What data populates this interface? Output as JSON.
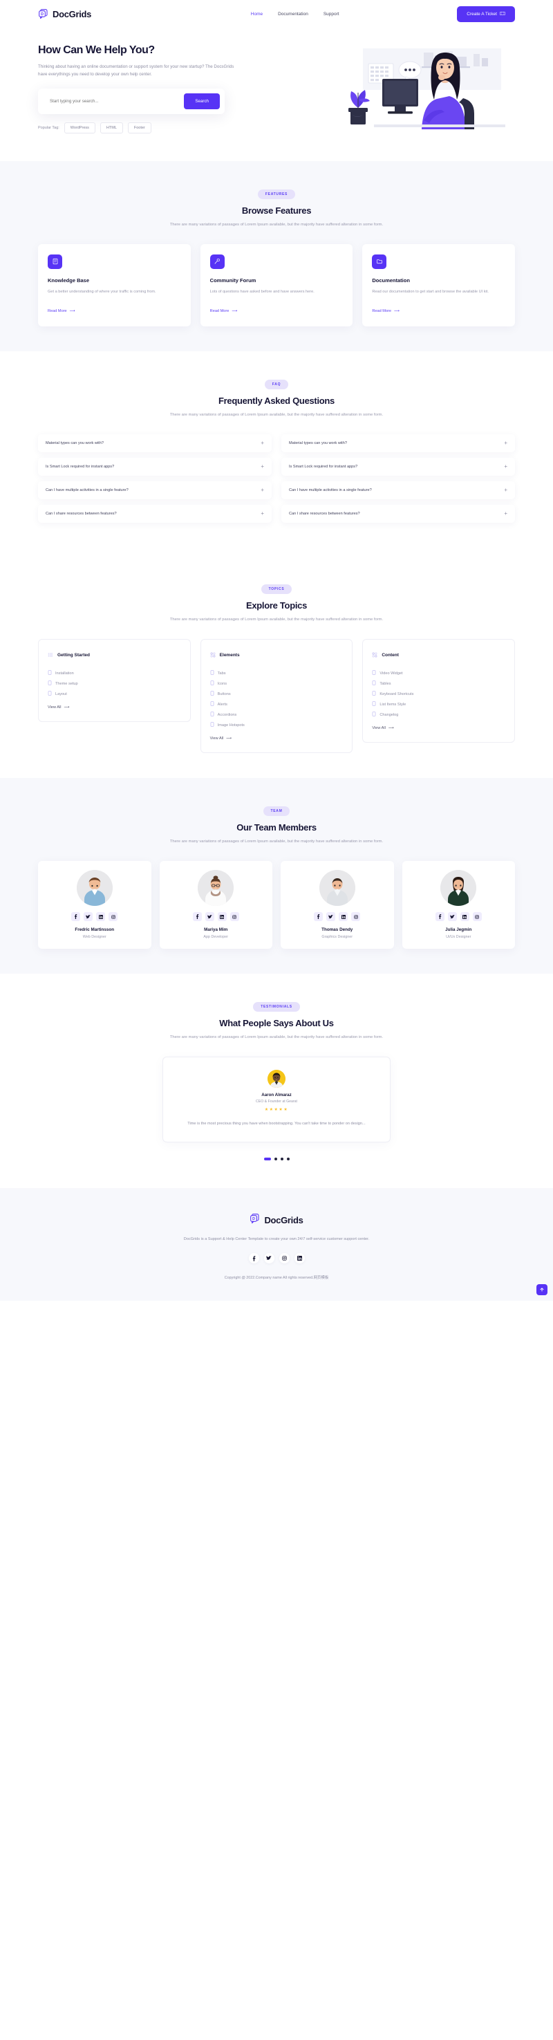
{
  "header": {
    "brand": "DocGrids",
    "brand_icon": "docgrids-logo-icon",
    "nav": [
      {
        "label": "Home",
        "active": true
      },
      {
        "label": "Documentation",
        "active": false
      },
      {
        "label": "Support",
        "active": false
      }
    ],
    "cta_label": "Create A Ticket",
    "cta_icon": "ticket-icon",
    "accent_color": "#5733f5"
  },
  "hero": {
    "title": "How Can We Help You?",
    "description": "Thinking about having an online documentation or support system for your new startup? The DocsGrids have everythings you need to develop your own help center.",
    "search_placeholder": "Start typing your search...",
    "search_value": "",
    "search_button": "Search",
    "tags_label": "Popular Tag:",
    "tags": [
      "WordPress",
      "HTML",
      "Footer"
    ]
  },
  "features": {
    "pill": "FEATURES",
    "title": "Browse Features",
    "description": "There are many variations of passages of Lorem Ipsum available, but the majority have suffered alteration in some form.",
    "read_more": "Read More",
    "cards": [
      {
        "icon": "book-icon",
        "title": "Knowledge Base",
        "description": "Get a better understanding of where your traffic is coming from."
      },
      {
        "icon": "microphone-icon",
        "title": "Community Forum",
        "description": "Lots of questions have asked before and have answers here."
      },
      {
        "icon": "folder-icon",
        "title": "Documentation",
        "description": "Read our documentation to get start and browse the available UI kit."
      }
    ]
  },
  "faq": {
    "pill": "FAQ",
    "title": "Frequently Asked Questions",
    "description": "There are many variations of passages of Lorem Ipsum available, but the majority have suffered alteration in some form.",
    "left_column": [
      "Material types can you work with?",
      "Is Smart Lock required for instant apps?",
      "Can I have multiple activities in a single feature?",
      "Can I share resources between features?"
    ],
    "right_column": [
      "Material types can you work with?",
      "Is Smart Lock required for instant apps?",
      "Can I have multiple activities in a single feature?",
      "Can I share resources between features?"
    ],
    "expand_icon": "plus-icon"
  },
  "topics": {
    "pill": "TOPICS",
    "title": "Explore Topics",
    "description": "There are many variations of passages of Lorem Ipsum available, but the majority have suffered alteration in some form.",
    "view_all": "View All",
    "cards": [
      {
        "icon": "list-icon",
        "title": "Getting Started",
        "items": [
          "Installation",
          "Theme setup",
          "Layout"
        ]
      },
      {
        "icon": "grid-icon",
        "title": "Elements",
        "items": [
          "Tabs",
          "Icons",
          "Buttons",
          "Alerts",
          "Accordions",
          "Image Hotspots"
        ]
      },
      {
        "icon": "grid-icon",
        "title": "Content",
        "items": [
          "Video Widget",
          "Tables",
          "Keyboard Shortcuts",
          "List Items Style",
          "Changelog"
        ]
      }
    ]
  },
  "team": {
    "pill": "TEAM",
    "title": "Our Team Members",
    "description": "There are many variations of passages of Lorem Ipsum available, but the majority have suffered alteration in some form.",
    "social_icons": [
      "facebook-icon",
      "twitter-icon",
      "linkedin-icon",
      "instagram-icon"
    ],
    "members": [
      {
        "name": "Fredric Martinsson",
        "role": "Web Designer"
      },
      {
        "name": "Mariya Mim",
        "role": "App Developer"
      },
      {
        "name": "Thomas Dendy",
        "role": "Graphics Designer"
      },
      {
        "name": "Julia Jegmin",
        "role": "Ui/Ux Designer"
      }
    ]
  },
  "testimonials": {
    "pill": "TESTIMONIALS",
    "title": "What People Says About Us",
    "description": "There are many variations of passages of Lorem Ipsum available, but the majority have suffered alteration in some form.",
    "current": {
      "name": "Aaron Almaraz",
      "role": "CEO & Founder at Gearat",
      "rating": 5,
      "stars": "★★★★★",
      "quote": "Time is the most precious thing you have when bootstrapping. You can't take time to ponder on design..."
    },
    "slides": 4,
    "active_slide": 1
  },
  "footer": {
    "brand": "DocGrids",
    "description": "DocGrids is a Support & Help Center Template to create your own 24/7 self-service customer support center.",
    "social_icons": [
      "facebook-icon",
      "twitter-icon",
      "instagram-icon",
      "linkedin-icon"
    ],
    "copyright": "Copyright @ 2022.Company name All rights reserved.网页模板",
    "scroll_top_icon": "arrow-up-icon"
  }
}
